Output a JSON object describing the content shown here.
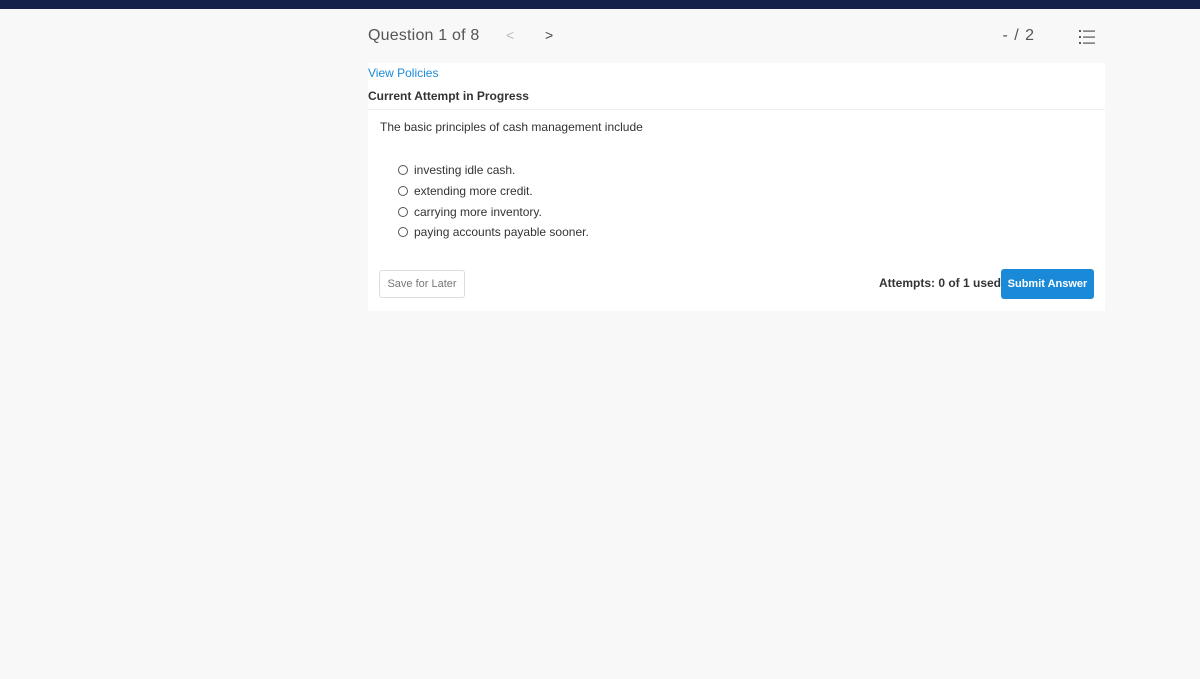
{
  "header": {
    "question_counter": "Question 1 of 8",
    "prev_icon": "<",
    "next_icon": ">",
    "score": "- / 2",
    "list_icon": "numbered-list-icon"
  },
  "card": {
    "view_policies": "View Policies",
    "attempt_title": "Current Attempt in Progress",
    "question_text": "The basic principles of cash management include",
    "options": [
      {
        "label": "investing idle cash.",
        "selected": false
      },
      {
        "label": "extending more credit.",
        "selected": false
      },
      {
        "label": "carrying more inventory.",
        "selected": false
      },
      {
        "label": "paying accounts payable sooner.",
        "selected": false
      }
    ],
    "save_label": "Save for Later",
    "attempts_text": "Attempts: 0 of 1 used",
    "submit_label": "Submit Answer"
  },
  "colors": {
    "topbar": "#15204a",
    "accent": "#1a8ad8",
    "background": "#f8f8f8"
  }
}
